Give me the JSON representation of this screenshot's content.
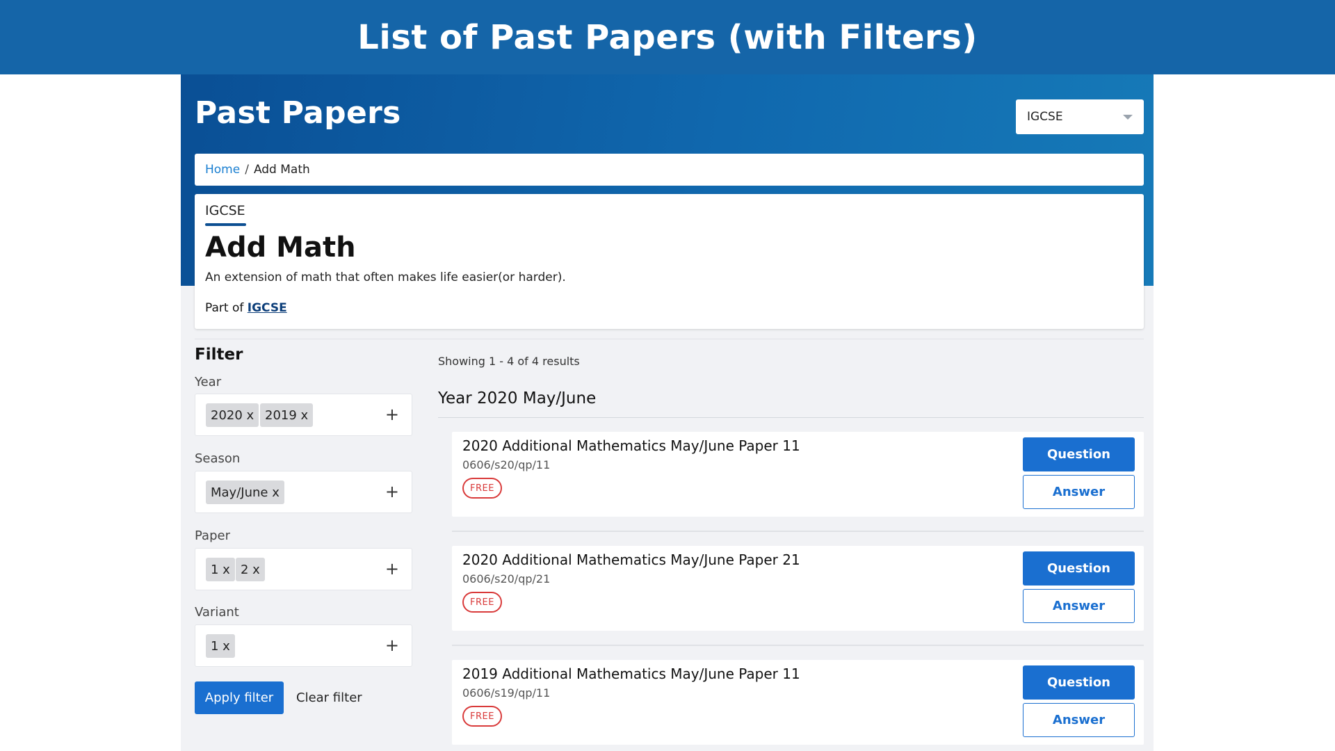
{
  "banner": {
    "title": "List of Past Papers (with Filters)"
  },
  "header": {
    "title": "Past Papers",
    "board_select": "IGCSE"
  },
  "breadcrumb": {
    "home": "Home",
    "separator": "/",
    "current": "Add Math"
  },
  "course": {
    "tag": "IGCSE",
    "title": "Add Math",
    "description": "An extension of math that often makes life easier(or harder).",
    "part_of_label": "Part of",
    "part_of_link": "IGCSE"
  },
  "filter": {
    "title": "Filter",
    "groups": [
      {
        "label": "Year",
        "chips": [
          "2020 x",
          "2019 x"
        ]
      },
      {
        "label": "Season",
        "chips": [
          "May/June x"
        ]
      },
      {
        "label": "Paper",
        "chips": [
          "1 x",
          "2 x"
        ]
      },
      {
        "label": "Variant",
        "chips": [
          "1 x"
        ]
      }
    ],
    "add_icon": "+",
    "apply_label": "Apply filter",
    "clear_label": "Clear filter"
  },
  "results": {
    "count_text": "Showing 1 - 4 of 4 results",
    "group_heading": "Year 2020 May/June",
    "papers": [
      {
        "title": "2020 Additional Mathematics May/June Paper 11",
        "code": "0606/s20/qp/11",
        "badge": "FREE",
        "question_label": "Question",
        "answer_label": "Answer"
      },
      {
        "title": "2020 Additional Mathematics May/June Paper 21",
        "code": "0606/s20/qp/21",
        "badge": "FREE",
        "question_label": "Question",
        "answer_label": "Answer"
      },
      {
        "title": "2019 Additional Mathematics May/June Paper 11",
        "code": "0606/s19/qp/11",
        "badge": "FREE",
        "question_label": "Question",
        "answer_label": "Answer"
      }
    ]
  },
  "colors": {
    "banner_bg": "#1565a8",
    "primary": "#1a6fd0",
    "link": "#1a7fd1",
    "free_badge": "#d93a3a",
    "app_bg": "#f1f2f5"
  },
  "icons": {
    "board_select_caret": "chevron-down-icon",
    "filter_add": "plus-icon"
  }
}
